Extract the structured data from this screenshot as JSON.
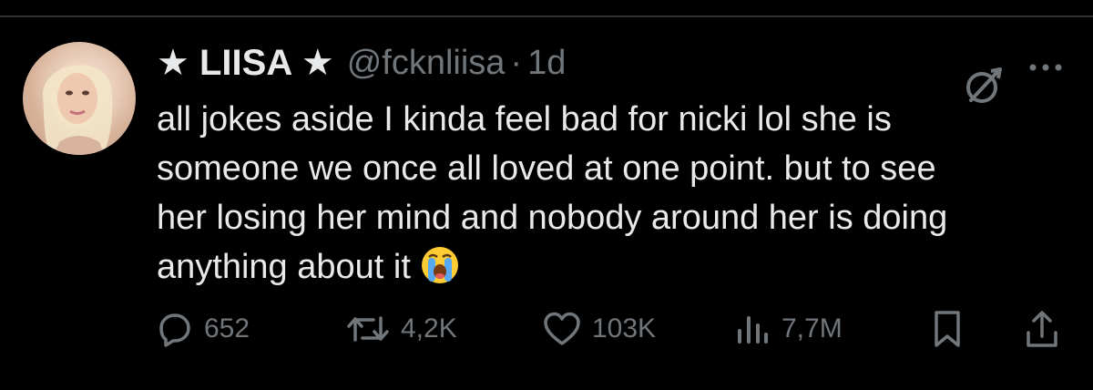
{
  "tweet": {
    "display_name": "★ LIISA ★",
    "handle": "@fcknliisa",
    "separator": "·",
    "time": "1d",
    "text": "all jokes aside I kinda feel bad for nicki lol she is\nsomeone we once all loved at one point. but to see\nher losing her mind and nobody around her is doing\nanything about it",
    "emoji": "loudly-crying-face"
  },
  "actions": {
    "replies": "652",
    "reposts": "4,2K",
    "likes": "103K",
    "views": "7,7M"
  },
  "icons": {
    "grok": "grok-icon",
    "more": "more-icon",
    "reply": "reply-icon",
    "repost": "repost-icon",
    "like": "heart-icon",
    "views": "views-icon",
    "bookmark": "bookmark-icon",
    "share": "share-icon"
  },
  "colors": {
    "background": "#000000",
    "text": "#e7e9ea",
    "secondary": "#71767b"
  }
}
